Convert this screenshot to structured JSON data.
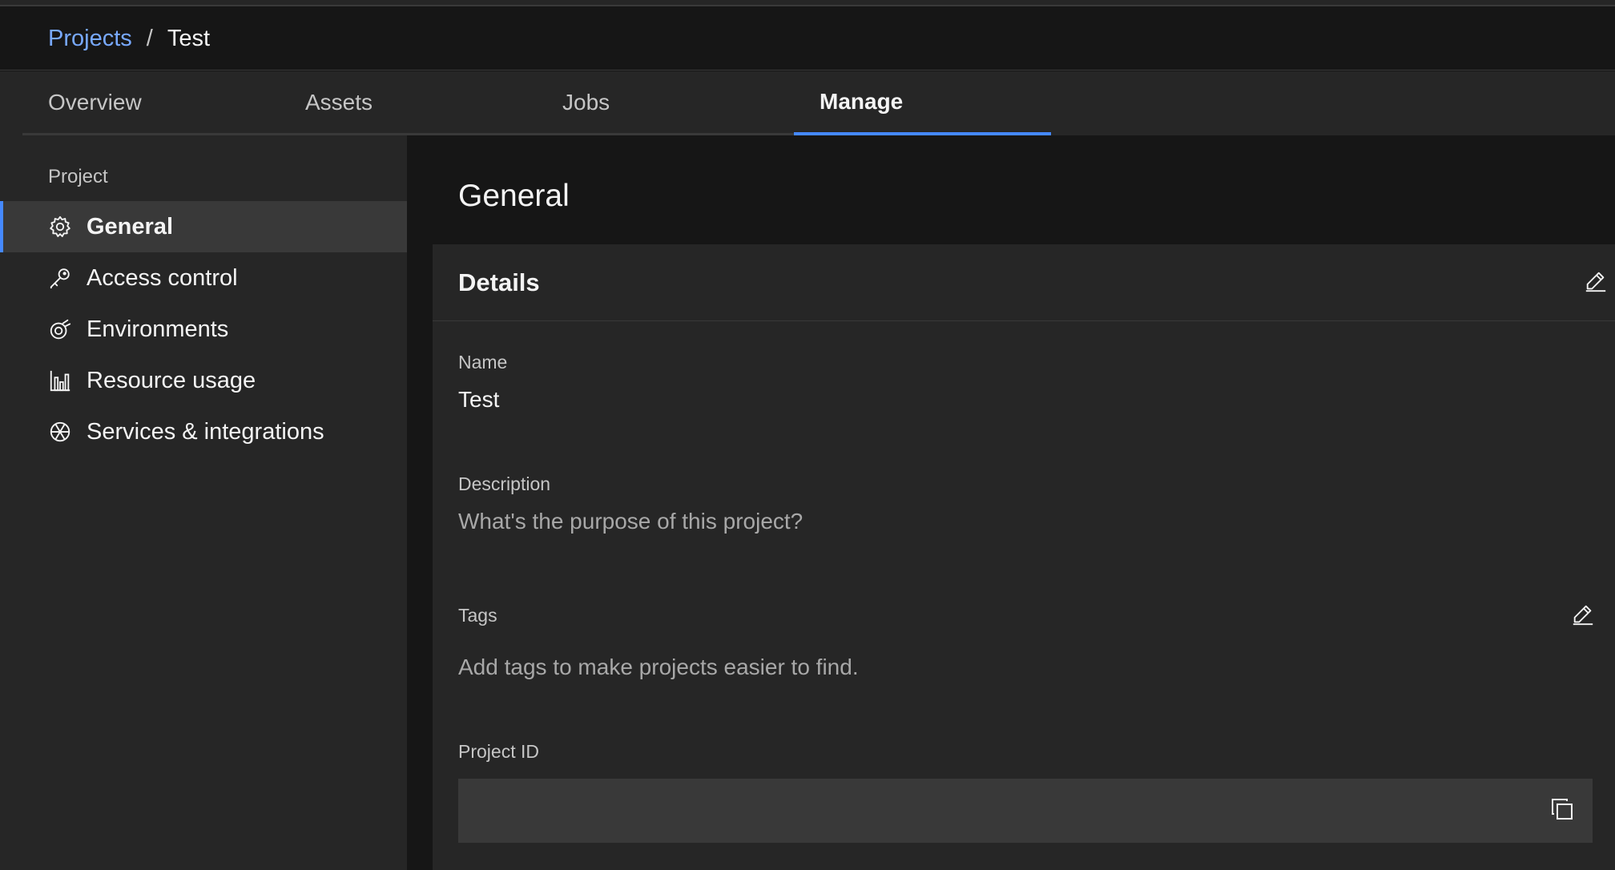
{
  "breadcrumb": {
    "root": "Projects",
    "separator": "/",
    "current": "Test"
  },
  "tabs": [
    {
      "label": "Overview",
      "active": false
    },
    {
      "label": "Assets",
      "active": false
    },
    {
      "label": "Jobs",
      "active": false
    },
    {
      "label": "Manage",
      "active": true
    }
  ],
  "sidebar": {
    "heading": "Project",
    "items": [
      {
        "label": "General",
        "icon": "gear-icon",
        "active": true
      },
      {
        "label": "Access control",
        "icon": "key-icon",
        "active": false
      },
      {
        "label": "Environments",
        "icon": "environment-icon",
        "active": false
      },
      {
        "label": "Resource usage",
        "icon": "bar-chart-icon",
        "active": false
      },
      {
        "label": "Services & integrations",
        "icon": "integrations-icon",
        "active": false
      }
    ]
  },
  "main": {
    "title": "General",
    "details": {
      "title": "Details",
      "name_label": "Name",
      "name_value": "Test",
      "description_label": "Description",
      "description_placeholder": "What's the purpose of this project?",
      "tags_label": "Tags",
      "tags_placeholder": "Add tags to make projects easier to find.",
      "project_id_label": "Project ID",
      "project_id_value": ""
    }
  },
  "colors": {
    "background": "#161616",
    "surface": "#262626",
    "surface_active": "#393939",
    "accent": "#4589ff",
    "link": "#78a9ff",
    "text_primary": "#f4f4f4",
    "text_secondary": "#c6c6c6"
  }
}
